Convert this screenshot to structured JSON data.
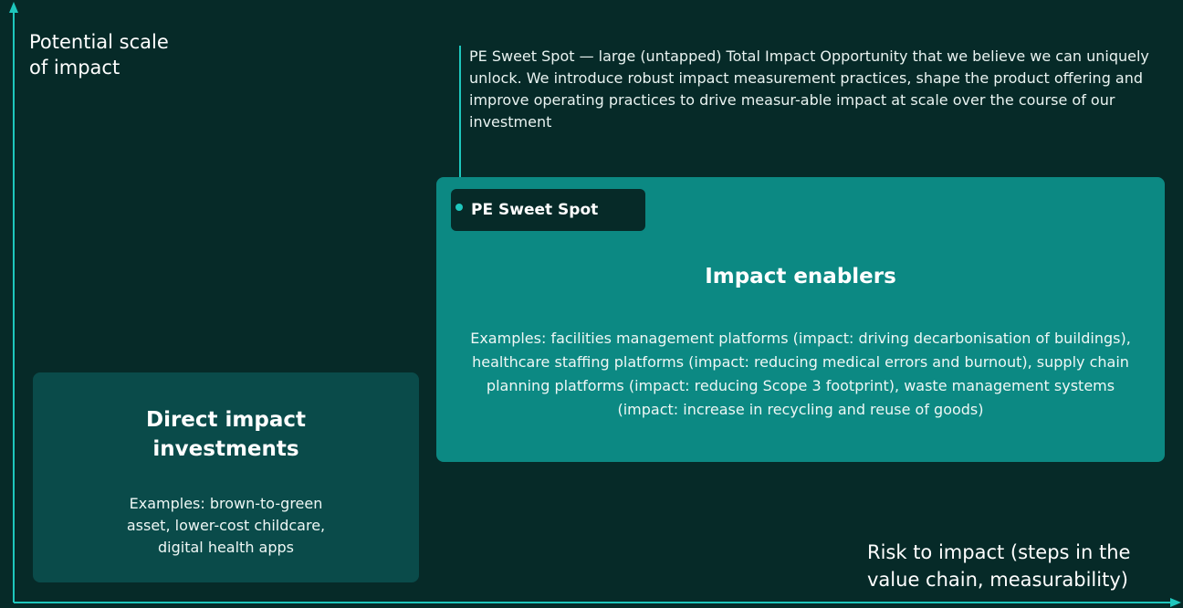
{
  "axes": {
    "y_label": "Potential scale\nof impact",
    "x_label": "Risk to impact (steps in the\nvalue chain, measurability)"
  },
  "callout": {
    "text": "PE Sweet Spot — large (untapped) Total Impact Opportunity that we believe we can uniquely unlock. We introduce robust impact measurement practices, shape the product offering and improve operating practices to drive measur-able impact at scale over the course of our investment"
  },
  "impact_enablers": {
    "badge": "PE Sweet Spot",
    "title": "Impact enablers",
    "examples": "Examples: facilities management platforms (impact: driving decarbonisation of buildings), healthcare staffing platforms (impact: reducing medical errors and burnout), supply chain planning platforms (impact: reducing Scope 3 footprint), waste management systems (impact: increase in recycling and reuse of goods)"
  },
  "direct_impact": {
    "title": "Direct impact\ninvestments",
    "examples": "Examples: brown-to-green\nasset, lower-cost childcare,\ndigital health apps"
  },
  "colors": {
    "background": "#062a28",
    "accent": "#1ec7bd",
    "enablers_box": "#0c8983",
    "direct_box": "#0a4b4a"
  }
}
